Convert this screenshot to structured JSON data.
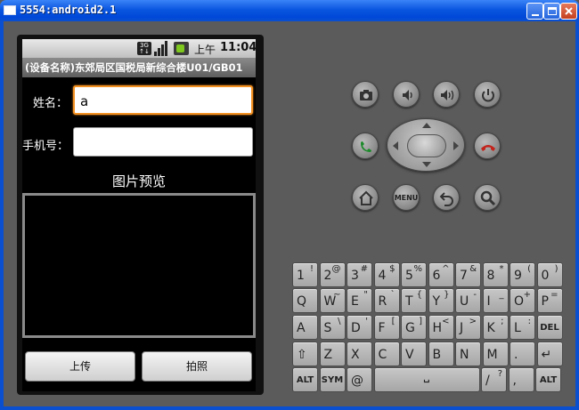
{
  "window": {
    "title": "5554:android2.1",
    "controls": [
      "minimize",
      "maximize",
      "close"
    ]
  },
  "status_bar": {
    "network": "3G",
    "ampm": "上午",
    "time": "11:04",
    "icons": [
      "3g-icon",
      "signal-icon",
      "battery-icon"
    ]
  },
  "app_bar": {
    "title": "(设备名称)东郊局区国税局新综合楼U01/GB01"
  },
  "form": {
    "name_label": "姓名：",
    "name_value": "a",
    "phone_label": "手机号：",
    "phone_value": ""
  },
  "preview": {
    "title": "图片预览"
  },
  "buttons": {
    "upload": "上传",
    "photo": "拍照"
  },
  "hardware": {
    "menu_label": "MENU",
    "buttons": [
      "camera",
      "volume-down",
      "volume-up",
      "power",
      "call",
      "dpad",
      "end-call",
      "home",
      "menu",
      "back",
      "search"
    ]
  },
  "keyboard": {
    "rows": [
      [
        [
          "1",
          "!"
        ],
        [
          "2",
          "@"
        ],
        [
          "3",
          "#"
        ],
        [
          "4",
          "$"
        ],
        [
          "5",
          "%"
        ],
        [
          "6",
          "^"
        ],
        [
          "7",
          "&"
        ],
        [
          "8",
          "*"
        ],
        [
          "9",
          "("
        ],
        [
          "0",
          ")"
        ]
      ],
      [
        [
          "Q",
          ""
        ],
        [
          "W",
          "~"
        ],
        [
          "E",
          "\""
        ],
        [
          "R",
          "`"
        ],
        [
          "T",
          "{"
        ],
        [
          "Y",
          "}"
        ],
        [
          "U",
          "-"
        ],
        [
          "I",
          "_"
        ],
        [
          "O",
          "+"
        ],
        [
          "P",
          "="
        ]
      ],
      [
        [
          "A",
          ""
        ],
        [
          "S",
          "\\"
        ],
        [
          "D",
          "'"
        ],
        [
          "F",
          "["
        ],
        [
          "G",
          "]"
        ],
        [
          "H",
          "<"
        ],
        [
          "J",
          ">"
        ],
        [
          "K",
          ";"
        ],
        [
          "L",
          ":"
        ],
        [
          "DEL",
          ""
        ]
      ],
      [
        [
          "⇧",
          ""
        ],
        [
          "Z",
          ""
        ],
        [
          "X",
          ""
        ],
        [
          "C",
          ""
        ],
        [
          "V",
          ""
        ],
        [
          "B",
          ""
        ],
        [
          "N",
          ""
        ],
        [
          "M",
          ""
        ],
        [
          ".",
          ""
        ],
        [
          "↵",
          ""
        ]
      ],
      [
        [
          "ALT",
          ""
        ],
        [
          "SYM",
          ""
        ],
        [
          "@",
          ""
        ],
        [
          "␣",
          ""
        ],
        [
          "/",
          "?"
        ],
        [
          ",",
          ""
        ],
        [
          "ALT",
          ""
        ]
      ]
    ]
  },
  "colors": {
    "title_blue": "#0a56e0",
    "focus_orange": "#f39122",
    "body_gray": "#5b5b5b"
  }
}
